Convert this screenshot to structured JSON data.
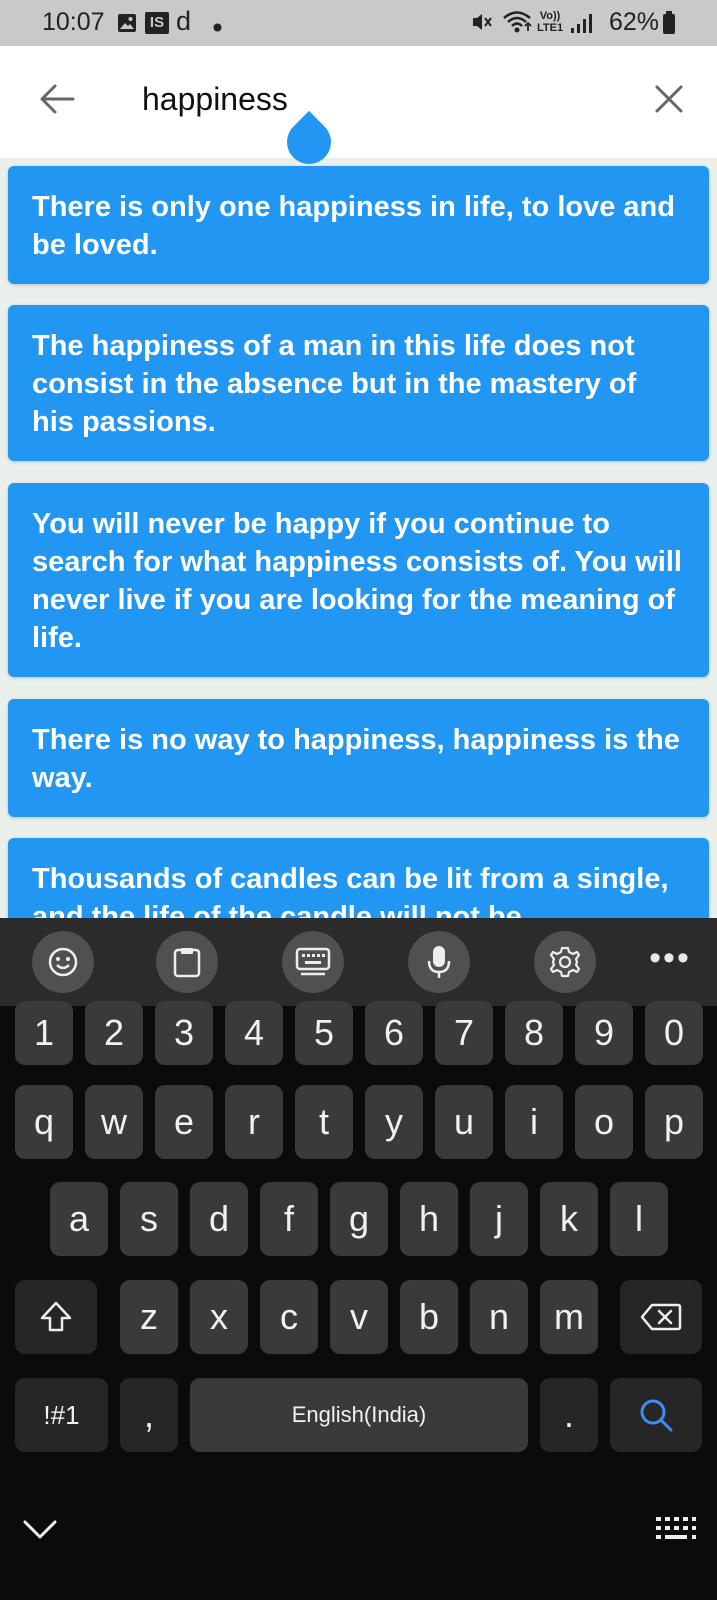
{
  "status_bar": {
    "time": "10:07",
    "battery": "62%",
    "icons": [
      "gallery-icon",
      "is-app-icon",
      "d-app-icon",
      "notification-dot-icon",
      "mute-icon",
      "wifi-icon",
      "volte-icon",
      "signal-icon",
      "battery-icon"
    ],
    "volte_label_top": "Vo))",
    "volte_label_bottom": "LTE1",
    "is_label": "IS",
    "d_label": "d"
  },
  "search": {
    "query": "happiness",
    "back_icon": "arrow-left-icon",
    "clear_icon": "close-icon"
  },
  "results": [
    {
      "text": "There is only one happiness in life, to love and be loved."
    },
    {
      "text": "The happiness of a man in this life does not consist in the absence but in the mastery of his passions."
    },
    {
      "text": "You will never be happy if you continue to search for what happiness consists of. You will never live if you are looking for the meaning of life."
    },
    {
      "text": "There is no way to happiness, happiness is the way."
    },
    {
      "text": "Thousands of candles can be lit from a single, and the life of the candle will not be"
    }
  ],
  "colors": {
    "accent": "#2196f3",
    "status_bar_bg": "#c9c9c9",
    "list_bg": "#e9f0ec",
    "keyboard_bg": "#0b0b0b",
    "key_bg": "#3a3a3a",
    "search_key_icon": "#3d8ef0"
  },
  "keyboard": {
    "toolbar": [
      "emoji-icon",
      "clipboard-icon",
      "keyboard-layout-icon",
      "microphone-icon",
      "settings-icon",
      "more-icon"
    ],
    "more_label": "•••",
    "row_numbers": [
      "1",
      "2",
      "3",
      "4",
      "5",
      "6",
      "7",
      "8",
      "9",
      "0"
    ],
    "row_top": [
      "q",
      "w",
      "e",
      "r",
      "t",
      "y",
      "u",
      "i",
      "o",
      "p"
    ],
    "row_middle": [
      "a",
      "s",
      "d",
      "f",
      "g",
      "h",
      "j",
      "k",
      "l"
    ],
    "row_bottom": [
      "z",
      "x",
      "c",
      "v",
      "b",
      "n",
      "m"
    ],
    "symbols_label": "!#1",
    "comma_label": ",",
    "space_label": "English(India)",
    "period_label": ".",
    "shift_icon": "shift-icon",
    "backspace_icon": "backspace-icon",
    "search_icon": "search-icon",
    "hide_icon": "chevron-down-icon",
    "switch_icon": "keyboard-icon"
  }
}
